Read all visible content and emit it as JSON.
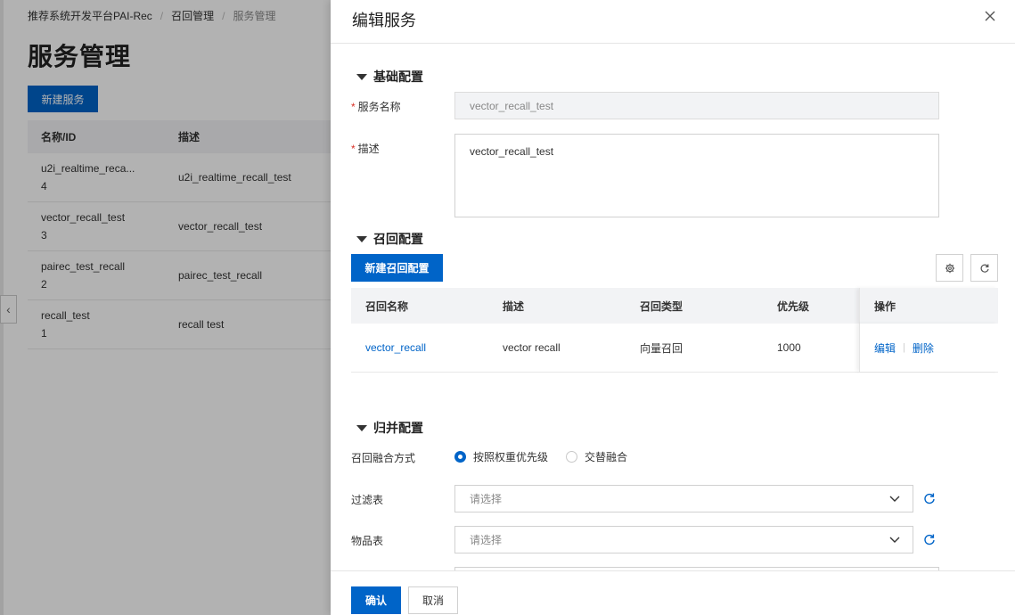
{
  "background": {
    "breadcrumb": [
      "推荐系统开发平台PAI-Rec",
      "召回管理",
      "服务管理"
    ],
    "page_title": "服务管理",
    "new_button": "新建服务",
    "table": {
      "headers": [
        "名称/ID",
        "描述"
      ],
      "rows": [
        {
          "name": "u2i_realtime_reca...",
          "id": "4",
          "desc": "u2i_realtime_recall_test"
        },
        {
          "name": "vector_recall_test",
          "id": "3",
          "desc": "vector_recall_test"
        },
        {
          "name": "pairec_test_recall",
          "id": "2",
          "desc": "pairec_test_recall"
        },
        {
          "name": "recall_test",
          "id": "1",
          "desc": "recall test"
        }
      ]
    },
    "pager_prev": "‹"
  },
  "drawer": {
    "title": "编辑服务",
    "basic": {
      "section": "基础配置",
      "name_label": "服务名称",
      "name_value": "vector_recall_test",
      "desc_label": "描述",
      "desc_value": "vector_recall_test",
      "required_mark": "*"
    },
    "recall": {
      "section": "召回配置",
      "new_button": "新建召回配置",
      "headers": [
        "召回名称",
        "描述",
        "召回类型",
        "优先级",
        "操作"
      ],
      "rows": [
        {
          "name": "vector_recall",
          "desc": "vector recall",
          "type": "向量召回",
          "priority": "1000",
          "edit": "编辑",
          "delete": "删除"
        }
      ]
    },
    "merge": {
      "section": "归并配置",
      "method_label": "召回融合方式",
      "options": [
        {
          "label": "按照权重优先级",
          "checked": true
        },
        {
          "label": "交替融合",
          "checked": false
        }
      ],
      "filter_label": "过滤表",
      "filter_placeholder": "请选择",
      "item_label": "物品表",
      "item_placeholder": "请选择"
    },
    "footer": {
      "confirm": "确认",
      "cancel": "取消"
    }
  },
  "colors": {
    "primary": "#0064c8",
    "required": "#d93026",
    "mask": "rgba(0,0,0,0.30)"
  }
}
